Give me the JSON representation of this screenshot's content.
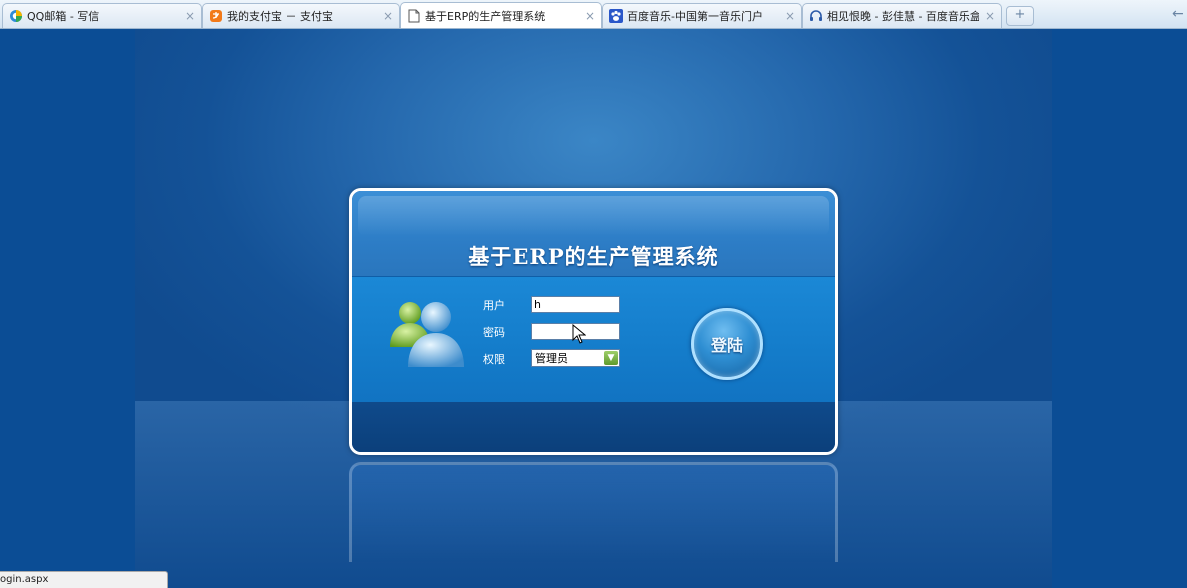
{
  "tabs": [
    {
      "label": "QQ邮箱 - 写信",
      "icon": "qq-mail-icon",
      "active": false
    },
    {
      "label": "我的支付宝 － 支付宝",
      "icon": "alipay-icon",
      "active": false
    },
    {
      "label": "基于ERP的生产管理系统",
      "icon": "document-icon",
      "active": true
    },
    {
      "label": "百度音乐-中国第一音乐门户",
      "icon": "baidu-paw-icon",
      "active": false
    },
    {
      "label": "相见恨晚 - 彭佳慧 - 百度音乐盒",
      "icon": "headphones-icon",
      "active": false
    }
  ],
  "tab_close_glyph": "×",
  "new_tab_glyph": "+",
  "back_glyph": "←",
  "login": {
    "title": "基于ERP的生产管理系统",
    "user_label": "用户",
    "user_value": "h",
    "password_label": "密码",
    "password_value": "",
    "role_label": "权限",
    "role_value": "管理员",
    "login_button": "登陆"
  },
  "status_bar": "ogin.aspx",
  "colors": {
    "page_bg": "#0b4d95",
    "panel_border": "#ffffff",
    "panel_mid": "#1b88d6"
  }
}
